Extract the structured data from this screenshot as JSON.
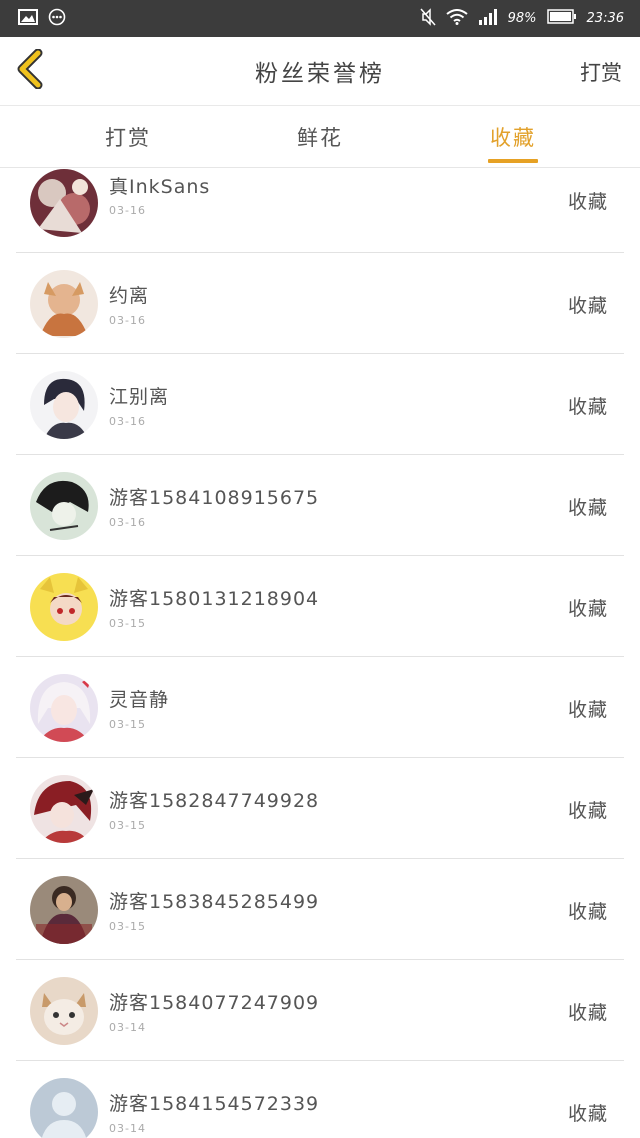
{
  "status_bar": {
    "battery": "98%",
    "time": "23:36"
  },
  "header": {
    "title": "粉丝荣誉榜",
    "action": "打赏"
  },
  "tabs": [
    {
      "label": "打赏",
      "active": false
    },
    {
      "label": "鲜花",
      "active": false
    },
    {
      "label": "收藏",
      "active": true
    }
  ],
  "accent_color": "#e6a124",
  "fans": [
    {
      "name": "真InkSans",
      "date": "03-16",
      "action": "收藏"
    },
    {
      "name": "约离",
      "date": "03-16",
      "action": "收藏"
    },
    {
      "name": "江别离",
      "date": "03-16",
      "action": "收藏"
    },
    {
      "name": "游客1584108915675",
      "date": "03-16",
      "action": "收藏"
    },
    {
      "name": "游客1580131218904",
      "date": "03-15",
      "action": "收藏"
    },
    {
      "name": "灵音静",
      "date": "03-15",
      "action": "收藏"
    },
    {
      "name": "游客1582847749928",
      "date": "03-15",
      "action": "收藏"
    },
    {
      "name": "游客1583845285499",
      "date": "03-15",
      "action": "收藏"
    },
    {
      "name": "游客1584077247909",
      "date": "03-14",
      "action": "收藏"
    },
    {
      "name": "游客1584154572339",
      "date": "03-14",
      "action": "收藏"
    }
  ]
}
